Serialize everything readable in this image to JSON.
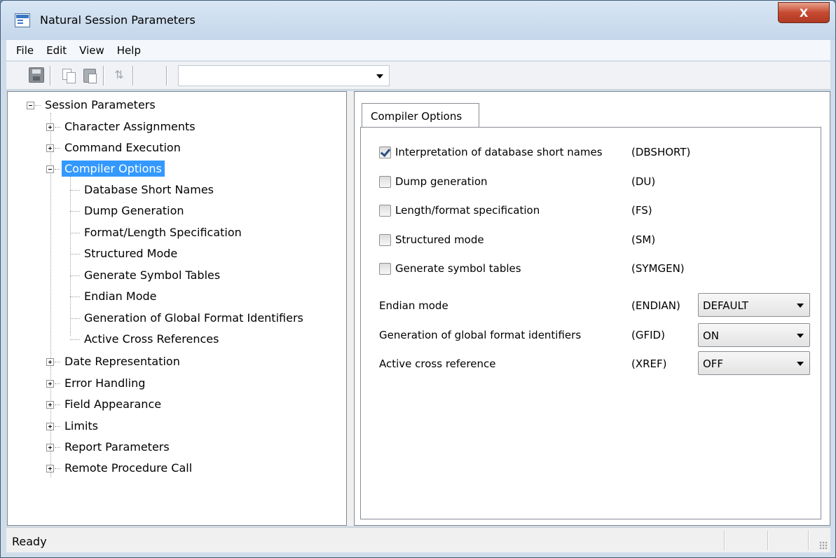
{
  "window": {
    "title": "Natural Session Parameters",
    "close_glyph": "X"
  },
  "menubar": {
    "items": [
      "File",
      "Edit",
      "View",
      "Help"
    ]
  },
  "toolbar": {
    "refresh_glyph": "⇅",
    "combo_value": ""
  },
  "tree": {
    "root": "Session Parameters",
    "items": [
      {
        "label": "Character Assignments",
        "expanded": false
      },
      {
        "label": "Command Execution",
        "expanded": false
      },
      {
        "label": "Compiler Options",
        "expanded": true,
        "selected": true,
        "children": [
          "Database Short Names",
          "Dump Generation",
          "Format/Length Specification",
          "Structured Mode",
          "Generate Symbol Tables",
          "Endian Mode",
          "Generation of Global Format Identifiers",
          "Active Cross References"
        ]
      },
      {
        "label": "Date Representation",
        "expanded": false
      },
      {
        "label": "Error Handling",
        "expanded": false
      },
      {
        "label": "Field Appearance",
        "expanded": false
      },
      {
        "label": "Limits",
        "expanded": false
      },
      {
        "label": "Report Parameters",
        "expanded": false
      },
      {
        "label": "Remote Procedure Call",
        "expanded": false
      }
    ]
  },
  "panel": {
    "tab": "Compiler Options",
    "checkboxes": [
      {
        "label": "Interpretation of database short names",
        "code": "(DBSHORT)",
        "checked": true
      },
      {
        "label": "Dump generation",
        "code": "(DU)",
        "checked": false
      },
      {
        "label": "Length/format specification",
        "code": "(FS)",
        "checked": false
      },
      {
        "label": "Structured mode",
        "code": "(SM)",
        "checked": false
      },
      {
        "label": "Generate symbol tables",
        "code": "(SYMGEN)",
        "checked": false
      }
    ],
    "selects": [
      {
        "label": "Endian mode",
        "code": "(ENDIAN)",
        "value": "DEFAULT"
      },
      {
        "label": "Generation of global format identifiers",
        "code": "(GFID)",
        "value": "ON"
      },
      {
        "label": "Active cross reference",
        "code": "(XREF)",
        "value": "OFF"
      }
    ]
  },
  "statusbar": {
    "text": "Ready"
  }
}
